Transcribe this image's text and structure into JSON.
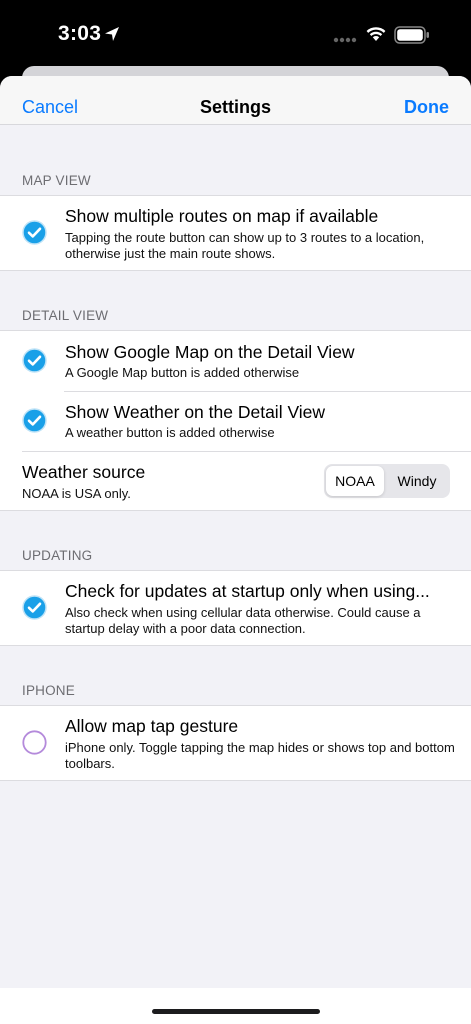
{
  "status_bar": {
    "time": "3:03",
    "icons": [
      "location-arrow-icon",
      "signal-dots-icon",
      "wifi-icon",
      "battery-icon"
    ]
  },
  "navbar": {
    "cancel_label": "Cancel",
    "title": "Settings",
    "done_label": "Done",
    "accent_color": "#0A7BFF"
  },
  "sections": {
    "map_view": {
      "header": "MAP VIEW",
      "items": [
        {
          "title": "Show multiple routes on map if available",
          "subtitle": "Tapping the route button can show up to 3 routes to a location, otherwise just the main route shows.",
          "checked": true
        }
      ]
    },
    "detail_view": {
      "header": "DETAIL VIEW",
      "items": [
        {
          "title": "Show Google Map on the Detail View",
          "subtitle": "A Google Map button is added otherwise",
          "checked": true
        },
        {
          "title": "Show Weather on the Detail View",
          "subtitle": "A weather button is added otherwise",
          "checked": true
        }
      ],
      "weather_source": {
        "title": "Weather source",
        "subtitle": "NOAA is USA only.",
        "options": [
          "NOAA",
          "Windy"
        ],
        "selected": "NOAA"
      }
    },
    "updating": {
      "header": "UPDATING",
      "items": [
        {
          "title": "Check for updates at startup only when using...",
          "subtitle": "Also check when using cellular data otherwise. Could cause a startup delay with a poor data connection.",
          "checked": true
        }
      ]
    },
    "iphone": {
      "header": "IPHONE",
      "items": [
        {
          "title": "Allow map tap gesture",
          "subtitle": "iPhone only.  Toggle tapping the map hides or shows top and bottom toolbars.",
          "checked": false
        }
      ]
    }
  },
  "colors": {
    "check_fill": "#1AA0E8",
    "unchecked_ring": "#B48ADB",
    "background": "#F2F2F7"
  }
}
